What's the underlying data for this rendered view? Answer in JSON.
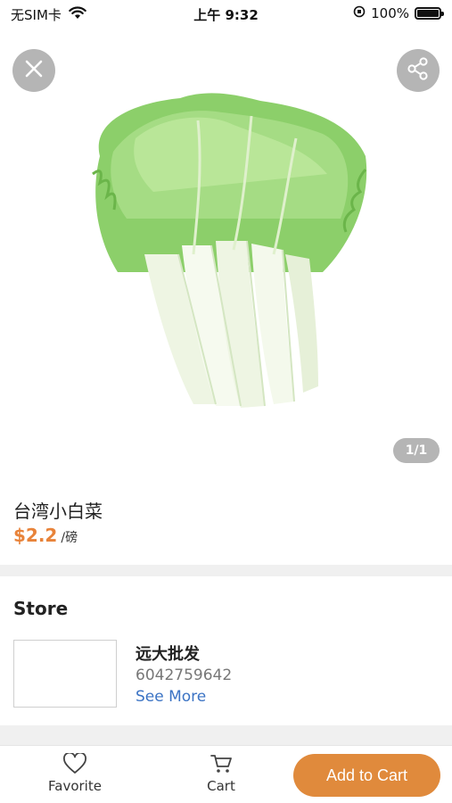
{
  "status_bar": {
    "carrier": "无SIM卡",
    "time": "上午 9:32",
    "battery_percent": "100%",
    "icons": [
      "wifi-icon",
      "orientation-lock-icon",
      "battery-icon"
    ]
  },
  "gallery": {
    "pager_text": "1/1",
    "icons": [
      "close-icon",
      "share-icon"
    ]
  },
  "product": {
    "name": "台湾小白菜",
    "price": "$2.2",
    "unit": "/磅"
  },
  "store": {
    "section_title": "Store",
    "name": "远大批发",
    "phone": "6042759642",
    "see_more": "See More"
  },
  "bottom_bar": {
    "favorite_label": "Favorite",
    "cart_label": "Cart",
    "add_to_cart_label": "Add to Cart",
    "icons": [
      "heart-icon",
      "cart-icon"
    ]
  },
  "colors": {
    "accent": "#e8833a",
    "button": "#e08a3c",
    "link": "#3b73c4",
    "overlay_button": "#b5b5b5"
  }
}
